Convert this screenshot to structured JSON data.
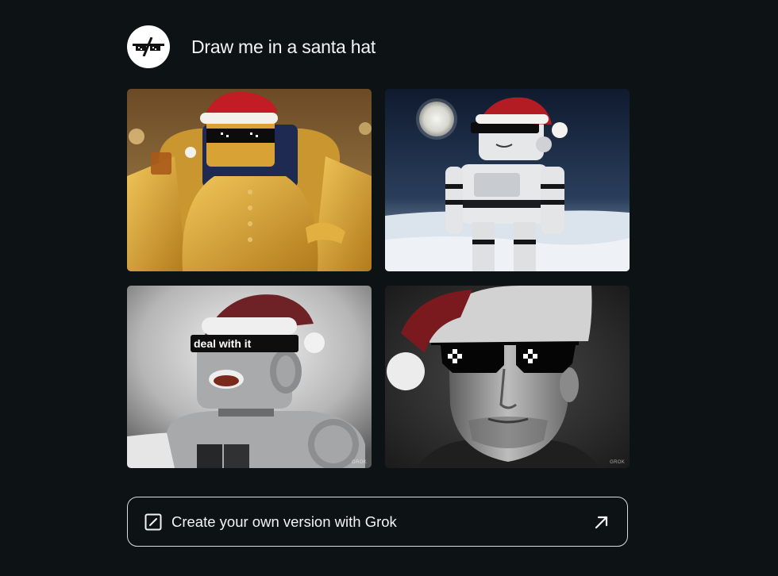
{
  "prompt": {
    "text": "Draw me in a santa hat",
    "avatar_icon": "pixel-sunglasses-icon"
  },
  "images": [
    {
      "alt": "Gold robot in santa hat and pixel sunglasses on throne",
      "watermark": ""
    },
    {
      "alt": "White robot in santa hat and sunglasses on snowy moonlit field",
      "watermark": ""
    },
    {
      "alt": "Grey robot in santa hat with deal with it sunglasses",
      "caption": "deal with it",
      "watermark": "GROK"
    },
    {
      "alt": "Man in santa hat and pixel sunglasses black and white portrait",
      "watermark": "GROK"
    }
  ],
  "cta": {
    "label": "Create your own version with Grok",
    "icon": "edit-square-icon",
    "arrow_icon": "arrow-up-right-icon"
  },
  "colors": {
    "background": "#0d1214",
    "text": "#f2f4f5",
    "border": "#d8dcde"
  }
}
